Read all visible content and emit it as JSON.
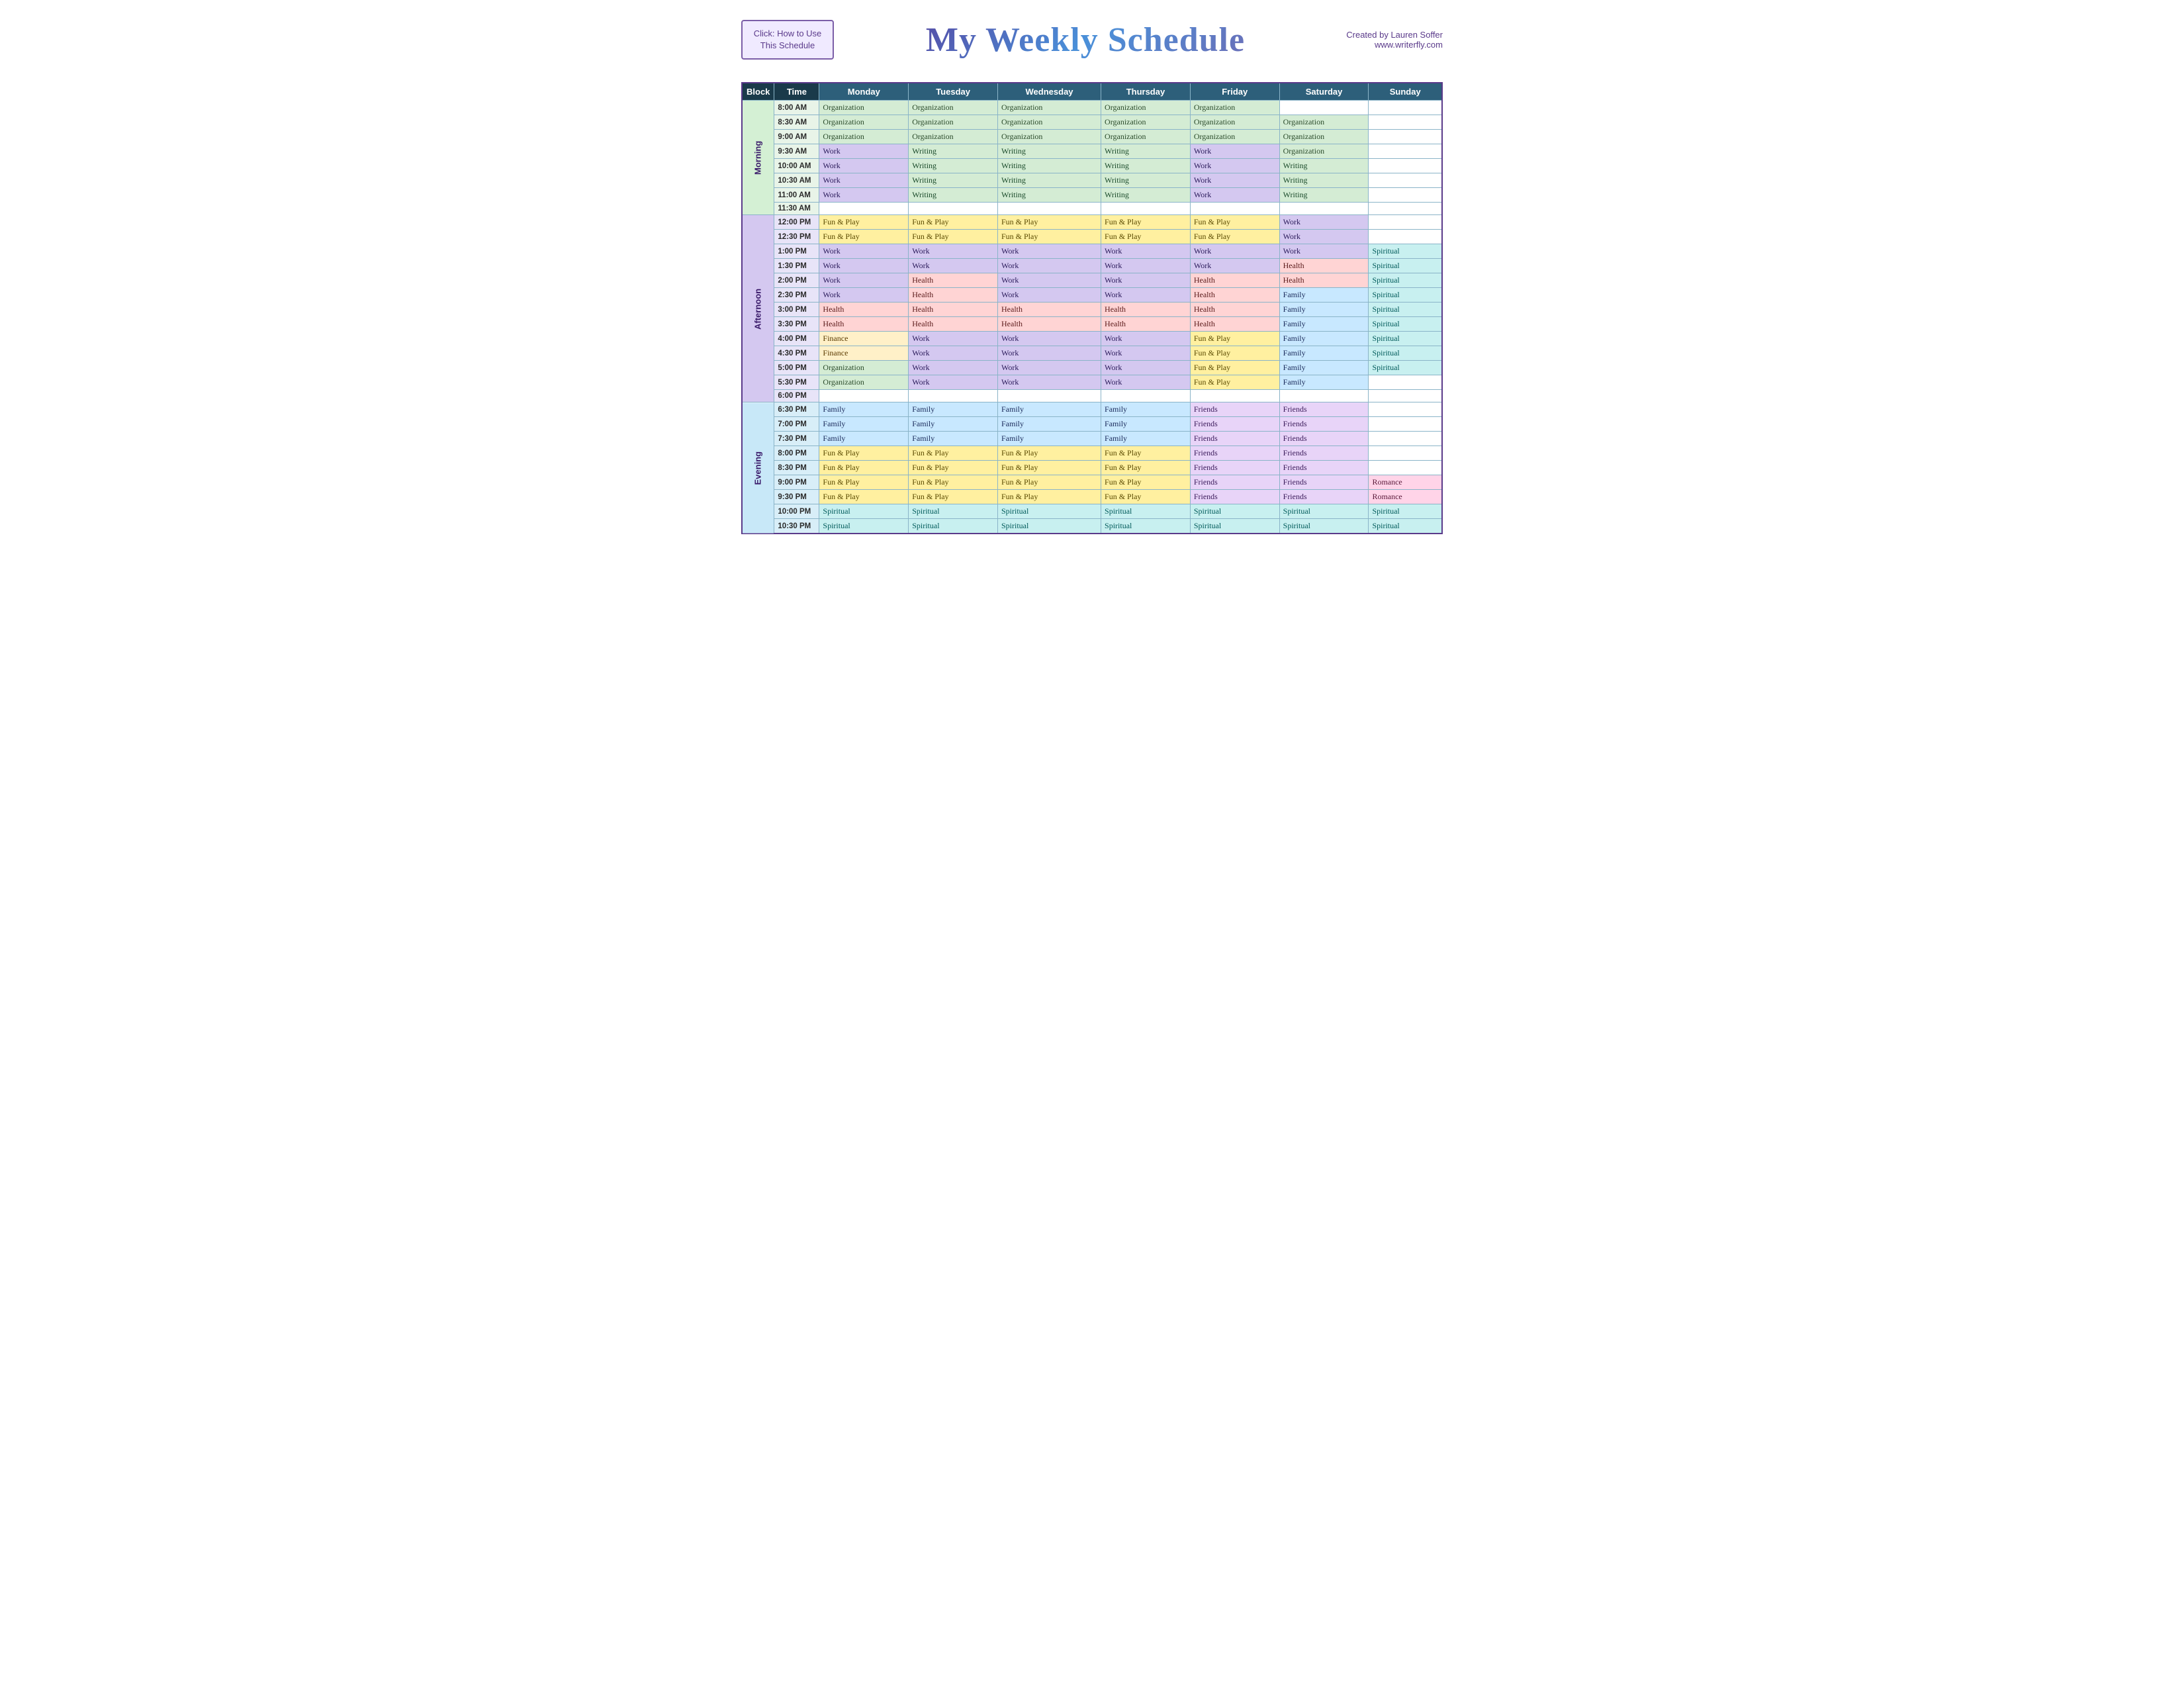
{
  "header": {
    "button_label": "Click: How to Use\nThis Schedule",
    "title": "My Weekly Schedule",
    "credit_name": "Created by Lauren Soffer",
    "credit_url": "www.writerfly.com"
  },
  "table": {
    "columns": [
      "Block",
      "Time",
      "Monday",
      "Tuesday",
      "Wednesday",
      "Thursday",
      "Friday",
      "Saturday",
      "Sunday"
    ],
    "blocks": [
      {
        "name": "Morning",
        "rows": [
          {
            "time": "8:00 AM",
            "mon": "Organization",
            "tue": "Organization",
            "wed": "Organization",
            "thu": "Organization",
            "fri": "Organization",
            "sat": "",
            "sun": ""
          },
          {
            "time": "8:30 AM",
            "mon": "Organization",
            "tue": "Organization",
            "wed": "Organization",
            "thu": "Organization",
            "fri": "Organization",
            "sat": "Organization",
            "sun": ""
          },
          {
            "time": "9:00 AM",
            "mon": "Organization",
            "tue": "Organization",
            "wed": "Organization",
            "thu": "Organization",
            "fri": "Organization",
            "sat": "Organization",
            "sun": ""
          },
          {
            "time": "9:30 AM",
            "mon": "Work",
            "tue": "Writing",
            "wed": "Writing",
            "thu": "Writing",
            "fri": "Work",
            "sat": "Organization",
            "sun": ""
          },
          {
            "time": "10:00 AM",
            "mon": "Work",
            "tue": "Writing",
            "wed": "Writing",
            "thu": "Writing",
            "fri": "Work",
            "sat": "Writing",
            "sun": ""
          },
          {
            "time": "10:30 AM",
            "mon": "Work",
            "tue": "Writing",
            "wed": "Writing",
            "thu": "Writing",
            "fri": "Work",
            "sat": "Writing",
            "sun": ""
          },
          {
            "time": "11:00 AM",
            "mon": "Work",
            "tue": "Writing",
            "wed": "Writing",
            "thu": "Writing",
            "fri": "Work",
            "sat": "Writing",
            "sun": ""
          },
          {
            "time": "11:30 AM",
            "mon": "",
            "tue": "",
            "wed": "",
            "thu": "",
            "fri": "",
            "sat": "",
            "sun": ""
          }
        ]
      },
      {
        "name": "Afternoon",
        "rows": [
          {
            "time": "12:00 PM",
            "mon": "Fun & Play",
            "tue": "Fun & Play",
            "wed": "Fun & Play",
            "thu": "Fun & Play",
            "fri": "Fun & Play",
            "sat": "Work",
            "sun": ""
          },
          {
            "time": "12:30 PM",
            "mon": "Fun & Play",
            "tue": "Fun & Play",
            "wed": "Fun & Play",
            "thu": "Fun & Play",
            "fri": "Fun & Play",
            "sat": "Work",
            "sun": ""
          },
          {
            "time": "1:00 PM",
            "mon": "Work",
            "tue": "Work",
            "wed": "Work",
            "thu": "Work",
            "fri": "Work",
            "sat": "Work",
            "sun": "Spiritual"
          },
          {
            "time": "1:30 PM",
            "mon": "Work",
            "tue": "Work",
            "wed": "Work",
            "thu": "Work",
            "fri": "Work",
            "sat": "Health",
            "sun": "Spiritual"
          },
          {
            "time": "2:00 PM",
            "mon": "Work",
            "tue": "Health",
            "wed": "Work",
            "thu": "Work",
            "fri": "Health",
            "sat": "Health",
            "sun": "Spiritual"
          },
          {
            "time": "2:30 PM",
            "mon": "Work",
            "tue": "Health",
            "wed": "Work",
            "thu": "Work",
            "fri": "Health",
            "sat": "Family",
            "sun": "Spiritual"
          },
          {
            "time": "3:00 PM",
            "mon": "Health",
            "tue": "Health",
            "wed": "Health",
            "thu": "Health",
            "fri": "Health",
            "sat": "Family",
            "sun": "Spiritual"
          },
          {
            "time": "3:30 PM",
            "mon": "Health",
            "tue": "Health",
            "wed": "Health",
            "thu": "Health",
            "fri": "Health",
            "sat": "Family",
            "sun": "Spiritual"
          },
          {
            "time": "4:00 PM",
            "mon": "Finance",
            "tue": "Work",
            "wed": "Work",
            "thu": "Work",
            "fri": "Fun & Play",
            "sat": "Family",
            "sun": "Spiritual"
          },
          {
            "time": "4:30 PM",
            "mon": "Finance",
            "tue": "Work",
            "wed": "Work",
            "thu": "Work",
            "fri": "Fun & Play",
            "sat": "Family",
            "sun": "Spiritual"
          },
          {
            "time": "5:00 PM",
            "mon": "Organization",
            "tue": "Work",
            "wed": "Work",
            "thu": "Work",
            "fri": "Fun & Play",
            "sat": "Family",
            "sun": "Spiritual"
          },
          {
            "time": "5:30 PM",
            "mon": "Organization",
            "tue": "Work",
            "wed": "Work",
            "thu": "Work",
            "fri": "Fun & Play",
            "sat": "Family",
            "sun": ""
          },
          {
            "time": "6:00 PM",
            "mon": "",
            "tue": "",
            "wed": "",
            "thu": "",
            "fri": "",
            "sat": "",
            "sun": ""
          }
        ]
      },
      {
        "name": "Evening",
        "rows": [
          {
            "time": "6:30 PM",
            "mon": "Family",
            "tue": "Family",
            "wed": "Family",
            "thu": "Family",
            "fri": "Friends",
            "sat": "Friends",
            "sun": ""
          },
          {
            "time": "7:00 PM",
            "mon": "Family",
            "tue": "Family",
            "wed": "Family",
            "thu": "Family",
            "fri": "Friends",
            "sat": "Friends",
            "sun": ""
          },
          {
            "time": "7:30 PM",
            "mon": "Family",
            "tue": "Family",
            "wed": "Family",
            "thu": "Family",
            "fri": "Friends",
            "sat": "Friends",
            "sun": ""
          },
          {
            "time": "8:00 PM",
            "mon": "Fun & Play",
            "tue": "Fun & Play",
            "wed": "Fun & Play",
            "thu": "Fun & Play",
            "fri": "Friends",
            "sat": "Friends",
            "sun": ""
          },
          {
            "time": "8:30 PM",
            "mon": "Fun & Play",
            "tue": "Fun & Play",
            "wed": "Fun & Play",
            "thu": "Fun & Play",
            "fri": "Friends",
            "sat": "Friends",
            "sun": ""
          },
          {
            "time": "9:00 PM",
            "mon": "Fun & Play",
            "tue": "Fun & Play",
            "wed": "Fun & Play",
            "thu": "Fun & Play",
            "fri": "Friends",
            "sat": "Friends",
            "sun": "Romance"
          },
          {
            "time": "9:30 PM",
            "mon": "Fun & Play",
            "tue": "Fun & Play",
            "wed": "Fun & Play",
            "thu": "Fun & Play",
            "fri": "Friends",
            "sat": "Friends",
            "sun": "Romance"
          },
          {
            "time": "10:00 PM",
            "mon": "Spiritual",
            "tue": "Spiritual",
            "wed": "Spiritual",
            "thu": "Spiritual",
            "fri": "Spiritual",
            "sat": "Spiritual",
            "sun": "Spiritual"
          },
          {
            "time": "10:30 PM",
            "mon": "Spiritual",
            "tue": "Spiritual",
            "wed": "Spiritual",
            "thu": "Spiritual",
            "fri": "Spiritual",
            "sat": "Spiritual",
            "sun": "Spiritual"
          }
        ]
      }
    ]
  }
}
